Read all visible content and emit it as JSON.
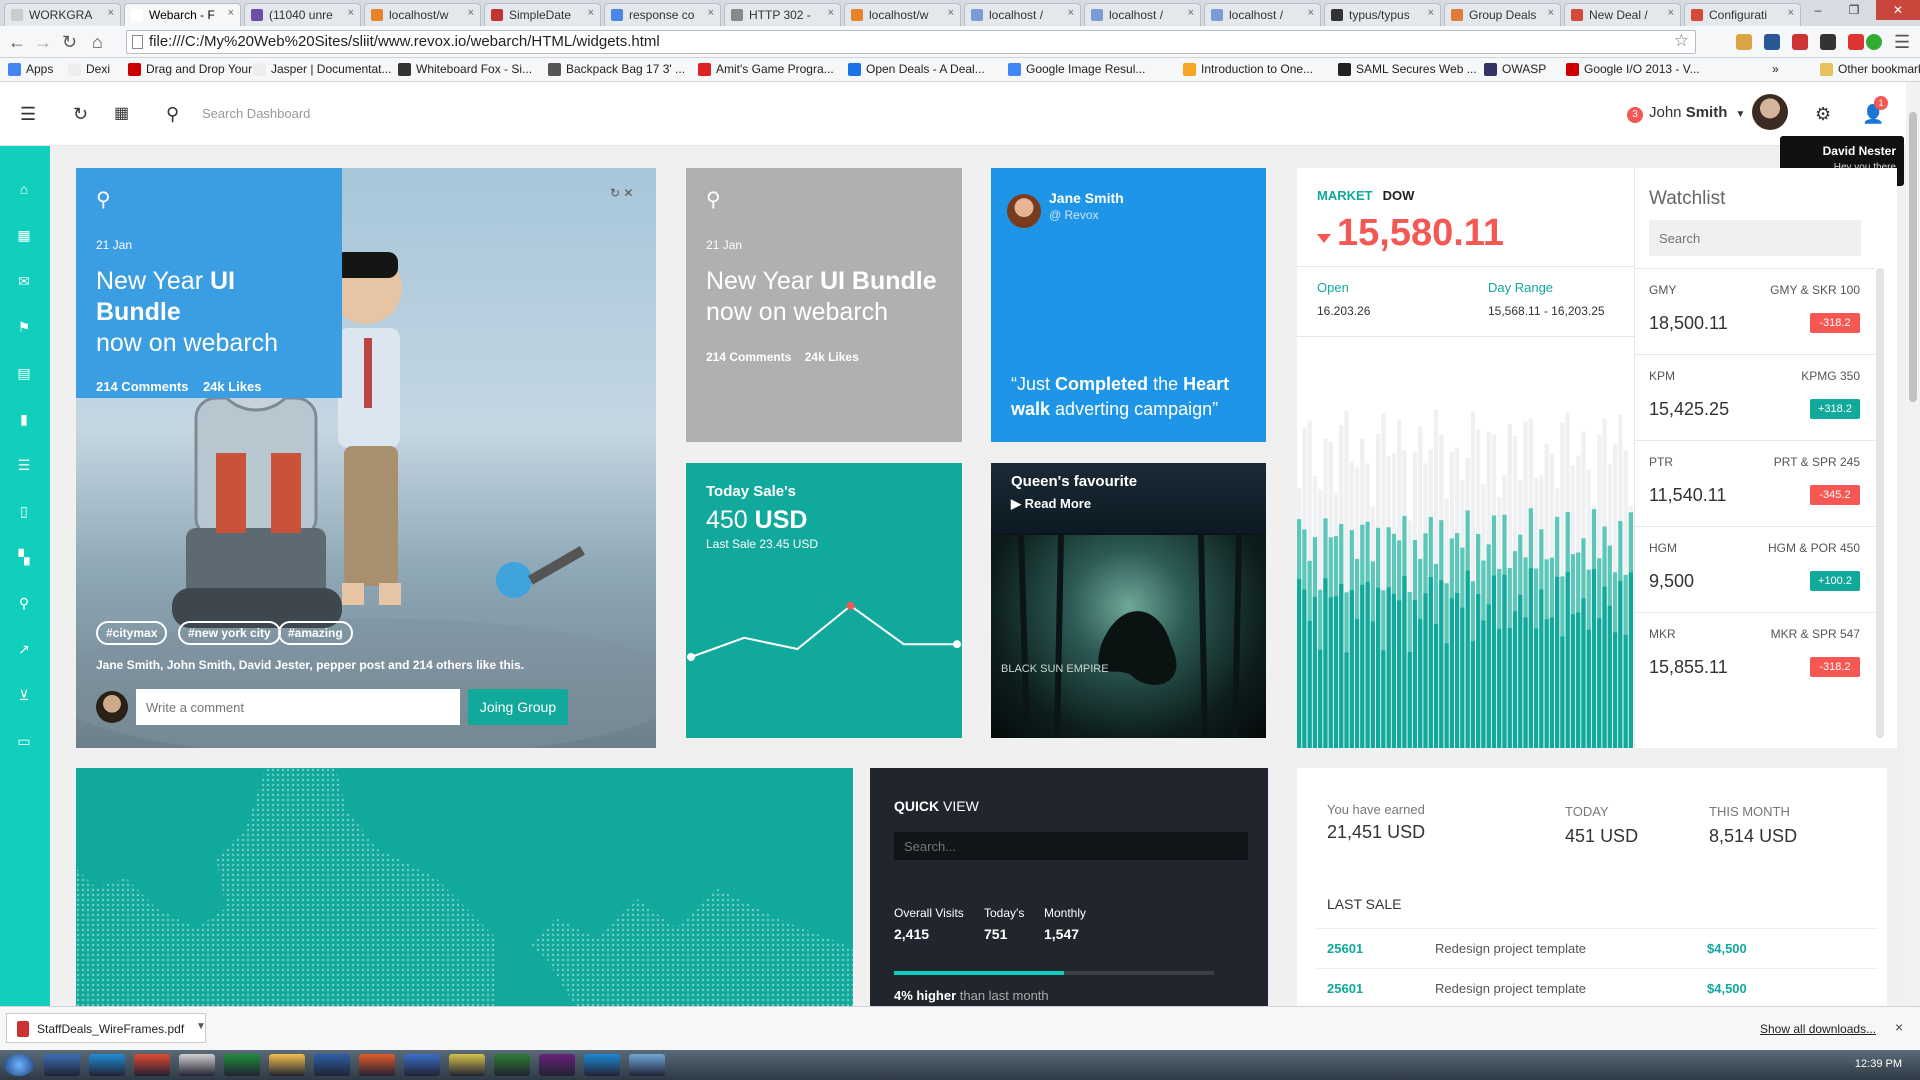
{
  "browser": {
    "tabs": [
      {
        "label": "WORKGRA",
        "color": "#cccccc"
      },
      {
        "label": "Webarch - F",
        "color": "#ffffff",
        "active": true
      },
      {
        "label": "(11040 unre",
        "color": "#6e4fa6"
      },
      {
        "label": "localhost/w",
        "color": "#e8832a"
      },
      {
        "label": "SimpleDate",
        "color": "#c33333"
      },
      {
        "label": "response co",
        "color": "#4a86e8"
      },
      {
        "label": "HTTP 302 -",
        "color": "#888888"
      },
      {
        "label": "localhost/w",
        "color": "#e8832a"
      },
      {
        "label": "localhost /",
        "color": "#7a9bd6"
      },
      {
        "label": "localhost /",
        "color": "#7a9bd6"
      },
      {
        "label": "localhost /",
        "color": "#7a9bd6"
      },
      {
        "label": "typus/typus",
        "color": "#333333"
      },
      {
        "label": "Group Deals",
        "color": "#e07b39"
      },
      {
        "label": "New Deal /",
        "color": "#d64a3a"
      },
      {
        "label": "Configurati",
        "color": "#d64a3a"
      }
    ],
    "url": "file:///C:/My%20Web%20Sites/sliit/www.revox.io/webarch/HTML/widgets.html",
    "bookmarks": [
      {
        "label": "Apps",
        "color": "#4285f4"
      },
      {
        "label": "Dexi",
        "color": "#eeeeee"
      },
      {
        "label": "Drag and Drop Your ...",
        "color": "#cc0000"
      },
      {
        "label": "Jasper | Documentat...",
        "color": "#eeeeee"
      },
      {
        "label": "Whiteboard Fox - Si...",
        "color": "#333333"
      },
      {
        "label": "Backpack Bag 17 3' ...",
        "color": "#555555"
      },
      {
        "label": "Amit's Game Progra...",
        "color": "#d22"
      },
      {
        "label": "Open Deals - A Deal...",
        "color": "#1a73e8"
      },
      {
        "label": "Google Image Resul...",
        "color": "#4285f4"
      },
      {
        "label": "Introduction to One...",
        "color": "#f5a623"
      },
      {
        "label": "SAML Secures Web ...",
        "color": "#222222"
      },
      {
        "label": "OWASP",
        "color": "#333366"
      },
      {
        "label": "Google I/O 2013 - V...",
        "color": "#cc0000"
      }
    ],
    "bookmarks_more": "»",
    "other_bookmarks": "Other bookmarks"
  },
  "header": {
    "search_placeholder": "Search Dashboard",
    "notif_count": "3",
    "user_first": "John",
    "user_last": "Smith",
    "chat_count": "1",
    "tooltip_name": "David Nester",
    "tooltip_sub": "Hey you there"
  },
  "hero": {
    "date": "21 Jan",
    "title_pre": "New Year",
    "title_bold": "UI Bundle",
    "title_post": "now on webarch",
    "comments": "214 Comments",
    "likes": "24k Likes",
    "tags": [
      "#citymax",
      "#new york city",
      "#amazing"
    ],
    "liked_by": "Jane Smith, John Smith, David Jester, pepper post and 214 others like this.",
    "comment_placeholder": "Write a comment",
    "join_label": "Joing Group"
  },
  "grey_card": {
    "date": "21 Jan",
    "title_pre": "New Year",
    "title_bold": "UI Bundle",
    "title_post": "now on webarch",
    "comments": "214 Comments",
    "likes": "24k Likes"
  },
  "jane_card": {
    "name": "Jane Smith",
    "handle": "@ Revox",
    "quote_pre": "“Just",
    "quote_b1": "Completed",
    "quote_mid": "the",
    "quote_b2": "Heart walk",
    "quote_post": "adverting campaign”"
  },
  "sale": {
    "title": "Today Sale's",
    "amount": "450",
    "currency": "USD",
    "last": "Last Sale 23.45 USD",
    "chart_points": [
      10,
      22,
      15,
      42,
      18,
      18
    ]
  },
  "queen": {
    "title": "Queen's favourite",
    "read_more": "Read More",
    "album_text": "BLACK SUN EMPIRE"
  },
  "market": {
    "label": "MARKET",
    "index": "DOW",
    "value": "15,580.11",
    "open_label": "Open",
    "open_value": "16.203.26",
    "range_label": "Day Range",
    "range_value": "15,568.11 - 16,203.25",
    "watchlist_title": "Watchlist",
    "watch_search_placeholder": "Search",
    "watch": [
      {
        "sym": "GMY",
        "cmp": "GMY & SKR 100",
        "val": "18,500.11",
        "chg": "-318.2",
        "color": "#f55753"
      },
      {
        "sym": "KPM",
        "cmp": "KPMG 350",
        "val": "15,425.25",
        "chg": "+318.2",
        "color": "#10a99b"
      },
      {
        "sym": "PTR",
        "cmp": "PRT & SPR 245",
        "val": "11,540.11",
        "chg": "-345.2",
        "color": "#f55753"
      },
      {
        "sym": "HGM",
        "cmp": "HGM & POR 450",
        "val": "9,500",
        "chg": "+100.2",
        "color": "#10a99b"
      },
      {
        "sym": "MKR",
        "cmp": "MKR & SPR 547",
        "val": "15,855.11",
        "chg": "-318.2",
        "color": "#f55753"
      }
    ]
  },
  "quick": {
    "title_bold": "QUICK",
    "title_rest": "VIEW",
    "search_placeholder": "Search...",
    "stats": [
      {
        "label": "Overall Visits",
        "value": "2,415"
      },
      {
        "label": "Today's",
        "value": "751"
      },
      {
        "label": "Monthly",
        "value": "1,547"
      }
    ],
    "progress": 0.53,
    "note_bold": "4% higher",
    "note_rest": "than last month"
  },
  "earnings": {
    "earned_label": "You have earned",
    "earned_value": "21,451",
    "today_label": "TODAY",
    "today_value": "451",
    "month_label": "THIS MONTH",
    "month_value": "8,514",
    "currency": "USD",
    "last_sale_title": "LAST SALE",
    "sales": [
      {
        "id": "25601",
        "desc": "Redesign project template",
        "amount": "$4,500"
      },
      {
        "id": "25601",
        "desc": "Redesign project template",
        "amount": "$4,500"
      }
    ]
  },
  "downloads": {
    "file": "StaffDeals_WireFrames.pdf",
    "show_all": "Show all downloads...",
    "close": "×"
  },
  "taskbar": {
    "clock": "12:39 PM",
    "apps": [
      "#3b6fb6",
      "#1f8dd6",
      "#e04a2f",
      "#d0d0d0",
      "#1e8f3a",
      "#f2c04c",
      "#2d5fa8",
      "#e35b2a",
      "#3a6ec7",
      "#d4c24a",
      "#2e7d32",
      "#68217a",
      "#1c8ad6",
      "#6fa8dc"
    ]
  },
  "sidebar_icons": [
    "home-icon",
    "grid-icon",
    "mail-icon",
    "flag-icon",
    "file-icon",
    "bookmark-icon",
    "list-icon",
    "book-icon",
    "apps-icon",
    "map-pin-icon",
    "chart-icon",
    "basket-icon",
    "folder-icon"
  ]
}
